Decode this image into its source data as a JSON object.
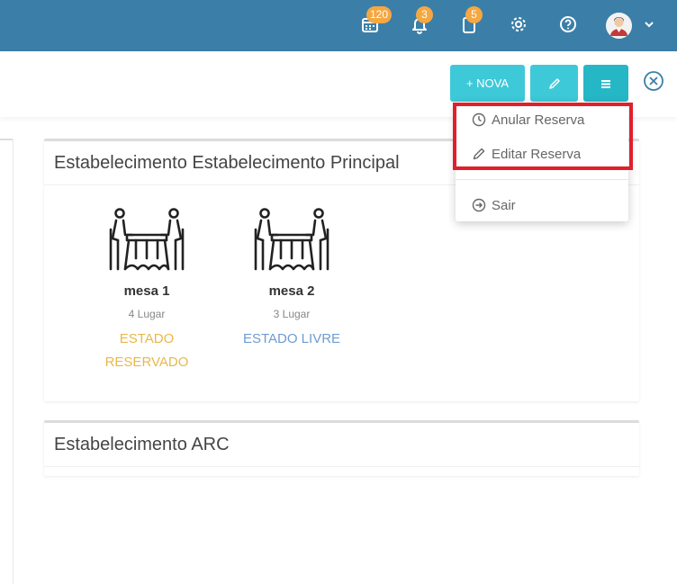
{
  "header": {
    "calendar_badge": "120",
    "bell_badge": "3",
    "clipboard_badge": "5",
    "icons": [
      "calendar-icon",
      "bell-icon",
      "clipboard-icon",
      "gear-icon",
      "help-icon",
      "avatar",
      "chevron-down-icon"
    ]
  },
  "toolbar": {
    "nova_label": "+ NOVA"
  },
  "dropdown": {
    "items": [
      {
        "label": "Anular Reserva",
        "icon": "clock-icon"
      },
      {
        "label": "Editar Reserva",
        "icon": "pencil-icon"
      },
      {
        "label": "Sair",
        "icon": "exit-circle-icon"
      }
    ]
  },
  "establishments": [
    {
      "title": "Estabelecimento Estabelecimento Principal",
      "tables": [
        {
          "name": "mesa 1",
          "seats": "4 Lugar",
          "status": "ESTADO RESERVADO",
          "status_color": "#e8b84a"
        },
        {
          "name": "mesa 2",
          "seats": "3 Lugar",
          "status": "ESTADO LIVRE",
          "status_color": "#6e9bd2"
        }
      ]
    },
    {
      "title": "Estabelecimento ARC",
      "tables": []
    }
  ],
  "colors": {
    "header": "#3b7fa8",
    "accent": "#3ec9d8",
    "badge": "#f5a742",
    "highlight": "#e0202c"
  }
}
